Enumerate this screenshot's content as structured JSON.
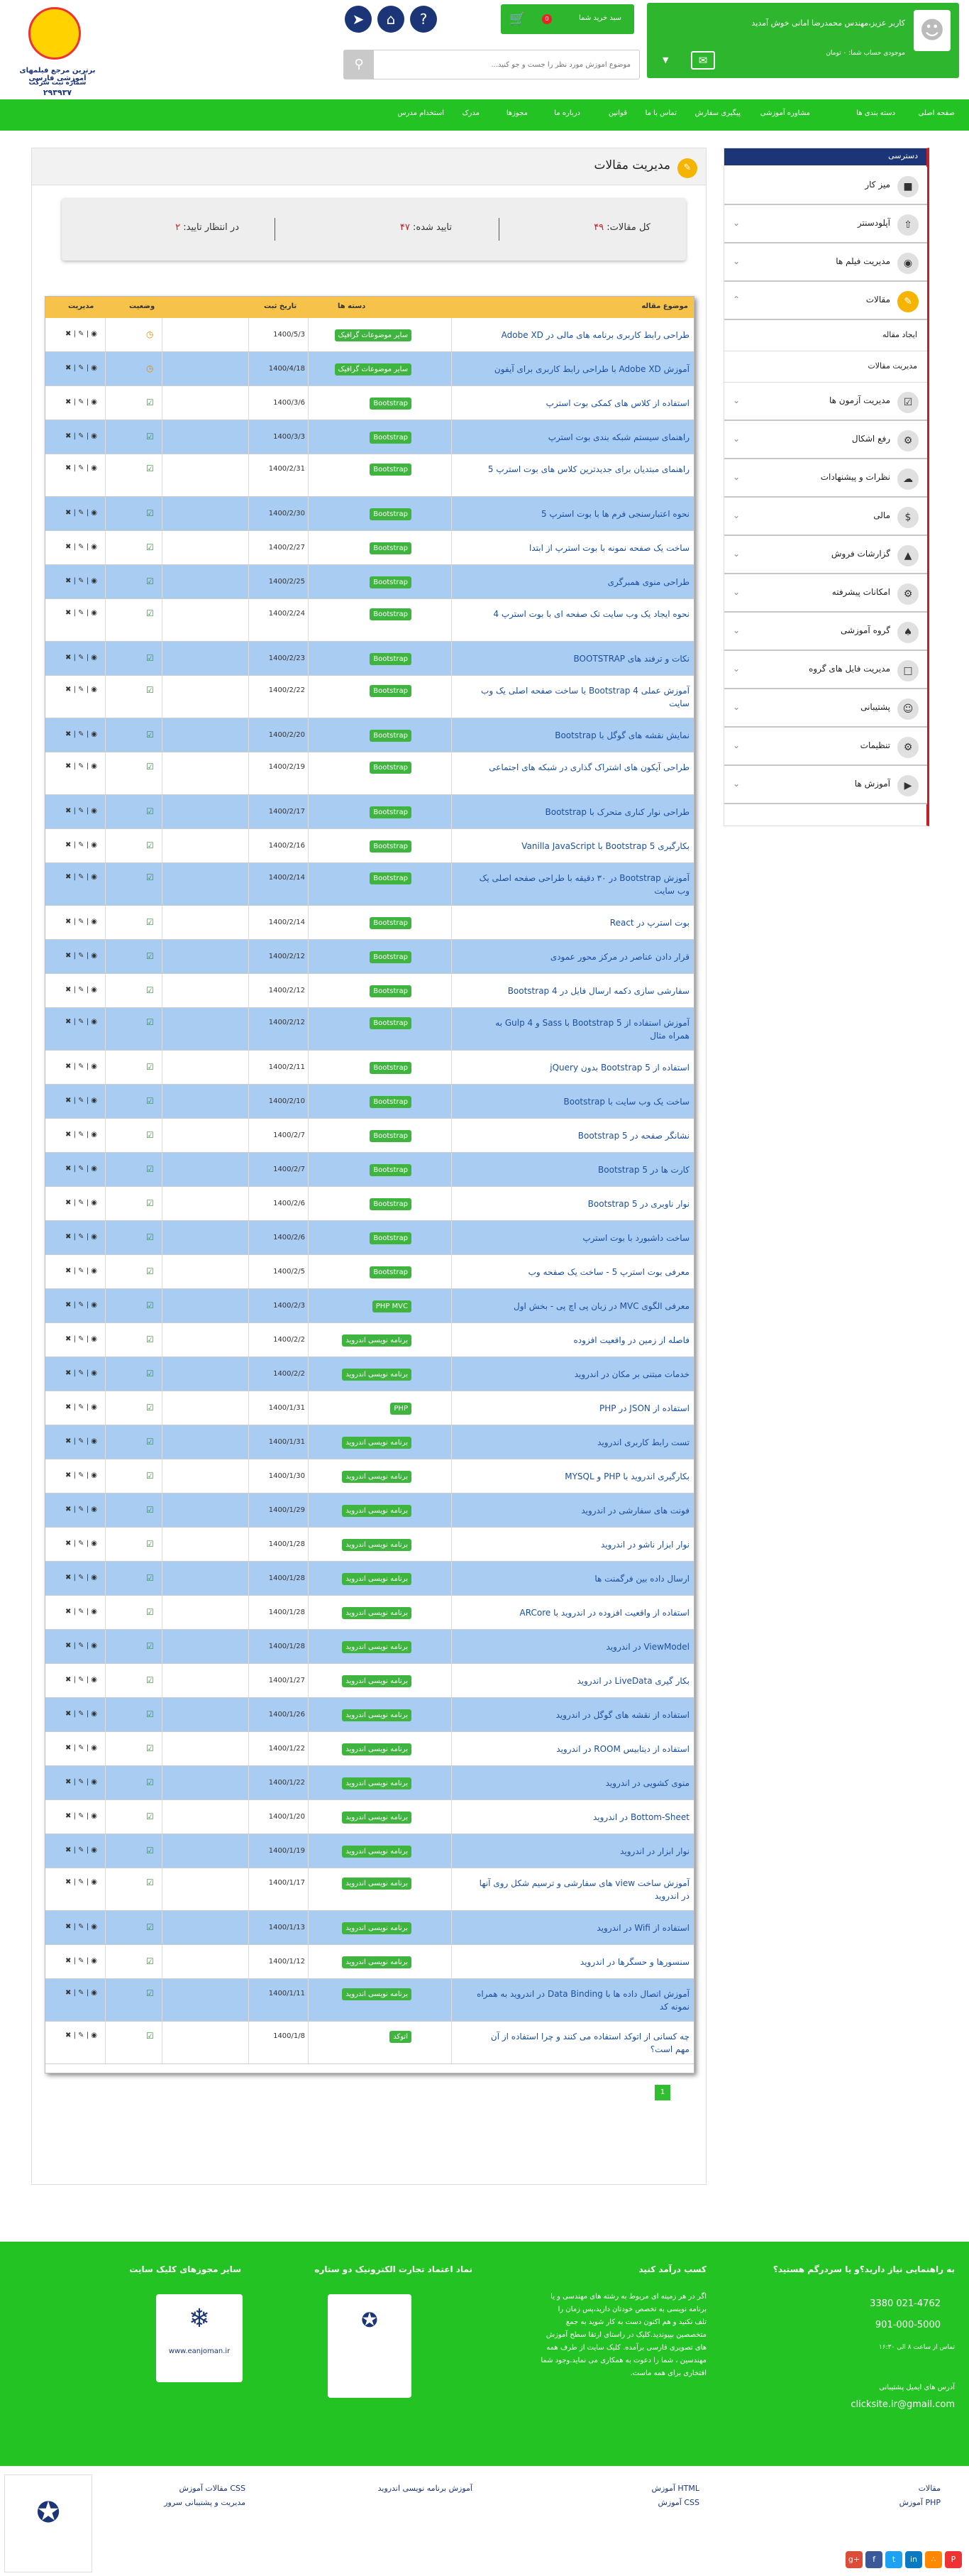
{
  "header": {
    "user_line": "کاربر عزیز،مهندس محمدرضا امانی خوش آمدید",
    "balance_line": "موجودی حساب شما: ۰ تومان",
    "cart_label": "سبد خرید شما",
    "cart_count": "0",
    "search_placeholder": "موضوع آموزش مورد نظر را جست و جو کنید...",
    "logo_line1": "برترین مرجع فیلمهای آموزشی فارسی",
    "logo_line2": "شماره ثبت شرکت",
    "logo_line3": "۲۹۳۹۳۷"
  },
  "nav": [
    "صفحه اصلی",
    "دسته بندی ها",
    "مشاوره آموزشی",
    "پیگیری سفارش",
    "تماس با ما",
    "قوانین",
    "درباره ما",
    "مجوزها",
    "مدرک",
    "استخدام مدرس"
  ],
  "sidebar": {
    "title": "دسترسی",
    "items": [
      "میز کار",
      "آپلودسنتر",
      "مدیریت فیلم ها",
      "مقالات",
      "مدیریت آزمون ها",
      "رفع اشکال",
      "نظرات و پیشنهادات",
      "مالی",
      "گزارشات فروش",
      "امکانات پیشرفته",
      "گروه آموزشی",
      "مدیریت فایل های گروه",
      "پشتیبانی",
      "تنظیمات",
      "آموزش ها"
    ],
    "sub": [
      "ایجاد مقاله",
      "مدیریت مقالات"
    ]
  },
  "page": {
    "title": "مدیریت مقالات",
    "stats": {
      "total_label": "کل مقالات:",
      "total": "۴۹",
      "approved_label": "تایید شده:",
      "approved": "۴۷",
      "pending_label": "در انتظار تایید:",
      "pending": "۲"
    },
    "columns": {
      "title": "موضوع مقاله",
      "date": "تاریخ ثبت",
      "category": "دسته ها",
      "status": "وضعیت",
      "manage": "مدیریت"
    },
    "rows": [
      {
        "title": "طراحی رابط کاربری برنامه های مالی در Adobe XD",
        "date": "1400/5/3",
        "cat": "سایر موضوعات گرافیک",
        "s": "p"
      },
      {
        "title": "آموزش Adobe XD با طراحی رابط کاربری برای آیفون",
        "date": "1400/4/18",
        "cat": "سایر موضوعات گرافیک",
        "s": "p"
      },
      {
        "title": "استفاده از کلاس های کمکی بوت استرپ",
        "date": "1400/3/6",
        "cat": "Bootstrap",
        "s": "a"
      },
      {
        "title": "راهنمای سیستم شبکه بندی بوت استرپ",
        "date": "1400/3/3",
        "cat": "Bootstrap",
        "s": "a"
      },
      {
        "title": "راهنمای مبتدیان برای جدیدترین کلاس های بوت استرپ 5",
        "date": "1400/2/31",
        "cat": "Bootstrap",
        "s": "a"
      },
      {
        "title": "نحوه اعتبارسنجی فرم ها با بوت استرپ 5",
        "date": "1400/2/30",
        "cat": "Bootstrap",
        "s": "a"
      },
      {
        "title": "ساخت یک صفحه نمونه با بوت استرپ از ابتدا",
        "date": "1400/2/27",
        "cat": "Bootstrap",
        "s": "a"
      },
      {
        "title": "طراحی منوی همبرگری",
        "date": "1400/2/25",
        "cat": "Bootstrap",
        "s": "a"
      },
      {
        "title": "نحوه ایجاد یک وب سایت تک صفحه ای با بوت استرپ 4",
        "date": "1400/2/24",
        "cat": "Bootstrap",
        "s": "a"
      },
      {
        "title": "نکات و ترفند های BOOTSTRAP",
        "date": "1400/2/23",
        "cat": "Bootstrap",
        "s": "a"
      },
      {
        "title": "آموزش عملی 4 Bootstrap با ساخت صفحه اصلی یک وب سایت",
        "date": "1400/2/22",
        "cat": "Bootstrap",
        "s": "a"
      },
      {
        "title": "نمایش نقشه های گوگل با Bootstrap",
        "date": "1400/2/20",
        "cat": "Bootstrap",
        "s": "a"
      },
      {
        "title": "طراحی آیکون های اشتراک گذاری در شبکه های اجتماعی",
        "date": "1400/2/19",
        "cat": "Bootstrap",
        "s": "a"
      },
      {
        "title": "طراحی نوار کناری متحرک با Bootstrap",
        "date": "1400/2/17",
        "cat": "Bootstrap",
        "s": "a"
      },
      {
        "title": "بکارگیری Bootstrap 5 با Vanilla JavaScript",
        "date": "1400/2/16",
        "cat": "Bootstrap",
        "s": "a"
      },
      {
        "title": "آموزش Bootstrap در ۳۰ دقیقه با طراحی صفحه اصلی یک وب سایت",
        "date": "1400/2/14",
        "cat": "Bootstrap",
        "s": "a"
      },
      {
        "title": "بوت استرپ در React",
        "date": "1400/2/14",
        "cat": "Bootstrap",
        "s": "a"
      },
      {
        "title": "قرار دادن عناصر در مرکز محور عمودی",
        "date": "1400/2/12",
        "cat": "Bootstrap",
        "s": "a"
      },
      {
        "title": "سفارشی سازی دکمه ارسال فایل در Bootstrap 4",
        "date": "1400/2/12",
        "cat": "Bootstrap",
        "s": "a"
      },
      {
        "title": "آموزش استفاده از Bootstrap 5 با Sass و Gulp 4 به همراه مثال",
        "date": "1400/2/12",
        "cat": "Bootstrap",
        "s": "a"
      },
      {
        "title": "استفاده از Bootstrap 5 بدون jQuery",
        "date": "1400/2/11",
        "cat": "Bootstrap",
        "s": "a"
      },
      {
        "title": "ساخت یک وب سایت با Bootstrap",
        "date": "1400/2/10",
        "cat": "Bootstrap",
        "s": "a"
      },
      {
        "title": "نشانگر صفحه در Bootstrap 5",
        "date": "1400/2/7",
        "cat": "Bootstrap",
        "s": "a"
      },
      {
        "title": "کارت ها در Bootstrap 5",
        "date": "1400/2/7",
        "cat": "Bootstrap",
        "s": "a"
      },
      {
        "title": "نوار ناوبری در Bootstrap 5",
        "date": "1400/2/6",
        "cat": "Bootstrap",
        "s": "a"
      },
      {
        "title": "ساخت داشبورد با بوت استرپ",
        "date": "1400/2/6",
        "cat": "Bootstrap",
        "s": "a"
      },
      {
        "title": "معرفی بوت استرپ 5 - ساخت یک صفحه وب",
        "date": "1400/2/5",
        "cat": "Bootstrap",
        "s": "a"
      },
      {
        "title": "معرفی الگوی MVC در زبان پی اچ پی - بخش اول",
        "date": "1400/2/3",
        "cat": "PHP MVC",
        "s": "a"
      },
      {
        "title": "فاصله از زمین در واقعیت افزوده",
        "date": "1400/2/2",
        "cat": "برنامه نویسی اندروید",
        "s": "a"
      },
      {
        "title": "خدمات مبتنی بر مکان در اندروید",
        "date": "1400/2/2",
        "cat": "برنامه نویسی اندروید",
        "s": "a"
      },
      {
        "title": "استفاده از JSON در PHP",
        "date": "1400/1/31",
        "cat": "PHP",
        "s": "a"
      },
      {
        "title": "تست رابط کاربری اندروید",
        "date": "1400/1/31",
        "cat": "برنامه نویسی اندروید",
        "s": "a"
      },
      {
        "title": "بکارگیری اندروید با PHP و MYSQL",
        "date": "1400/1/30",
        "cat": "برنامه نویسی اندروید",
        "s": "a"
      },
      {
        "title": "فونت های سفارشی در اندروید",
        "date": "1400/1/29",
        "cat": "برنامه نویسی اندروید",
        "s": "a"
      },
      {
        "title": "نوار ابزار ناشو در اندروید",
        "date": "1400/1/28",
        "cat": "برنامه نویسی اندروید",
        "s": "a"
      },
      {
        "title": "ارسال داده بین فرگمنت ها",
        "date": "1400/1/28",
        "cat": "برنامه نویسی اندروید",
        "s": "a"
      },
      {
        "title": "استفاده از واقعیت افزوده در اندروید با ARCore",
        "date": "1400/1/28",
        "cat": "برنامه نویسی اندروید",
        "s": "a"
      },
      {
        "title": "ViewModel در اندروید",
        "date": "1400/1/28",
        "cat": "برنامه نویسی اندروید",
        "s": "a"
      },
      {
        "title": "بکار گیری LiveData در اندروید",
        "date": "1400/1/27",
        "cat": "برنامه نویسی اندروید",
        "s": "a"
      },
      {
        "title": "استفاده از نقشه های گوگل در اندروید",
        "date": "1400/1/26",
        "cat": "برنامه نویسی اندروید",
        "s": "a"
      },
      {
        "title": "استفاده از دیتابیس ROOM در اندروید",
        "date": "1400/1/22",
        "cat": "برنامه نویسی اندروید",
        "s": "a"
      },
      {
        "title": "منوی کشویی در اندروید",
        "date": "1400/1/22",
        "cat": "برنامه نویسی اندروید",
        "s": "a"
      },
      {
        "title": "Bottom-Sheet در اندروید",
        "date": "1400/1/20",
        "cat": "برنامه نویسی اندروید",
        "s": "a"
      },
      {
        "title": "نوار ابزار در اندروید",
        "date": "1400/1/19",
        "cat": "برنامه نویسی اندروید",
        "s": "a"
      },
      {
        "title": "آموزش ساخت view های سفارشی و ترسیم شکل روی آنها در اندروید",
        "date": "1400/1/17",
        "cat": "برنامه نویسی اندروید",
        "s": "a"
      },
      {
        "title": "استفاده از Wifi در اندروید",
        "date": "1400/1/13",
        "cat": "برنامه نویسی اندروید",
        "s": "a"
      },
      {
        "title": "سنسورها و حسگرها در اندروید",
        "date": "1400/1/12",
        "cat": "برنامه نویسی اندروید",
        "s": "a"
      },
      {
        "title": "آموزش اتصال داده ها با Data Binding در اندروید به همراه نمونه کد",
        "date": "1400/1/11",
        "cat": "برنامه نویسی اندروید",
        "s": "a"
      },
      {
        "title": "چه کسانی از اتوکد استفاده می کنند و چرا استفاده از آن مهم است؟",
        "date": "1400/1/8",
        "cat": "اتوکد",
        "s": "a"
      }
    ],
    "pagination": "1"
  },
  "footer": {
    "col1_title": "به راهنمایی نیاز دارید؟و یا سردرگم هستید؟",
    "phone1": "021-4762 3380",
    "phone2": "901-000-5000",
    "hours": "تماس از ساعت ۸ الی ۱۶:۳۰",
    "email_label": "آدرس های ایمیل پشتیبانی",
    "email": "clicksite.ir@gmail.com",
    "col2_title": "کسب درآمد کنید",
    "col2_text": [
      "اگر در هر زمینه ای مربوط به رشته های مهندسی و یا",
      "برنامه نویسی به تخصص خودتان دارید،پس زمان را",
      "تلف نکنید و هم اکنون دست به کار شوید به جمع",
      "متخصصین بپیوندید.کلیک در راستای ارتقا سطح آموزش",
      "های تصویری فارسی برآمده. کلیک سایت از طرف همه",
      "مهندسین ، شما را دعوت به همکاری می نماید.وجود شما",
      "افتخاری برای همه ماست."
    ],
    "col3_title": "نماد اعتماد تجارت الکترونیک دو ستاره",
    "col4_title": "سایر مجوزهای کلیک سایت",
    "badge_text": "www.eanjoman.ir",
    "links": [
      "مقالات",
      "آموزش PHP",
      "آموزش HTML",
      "آموزش CSS",
      "آموزش برنامه نویسی اندروید",
      "مقالات آموزش CSS",
      "مدیریت و پشتیبانی سرور"
    ]
  },
  "colors": {
    "green": "#22c322",
    "navy": "#1b3577",
    "orange": "#f6c249",
    "rowblue": "#a9ccf3",
    "red": "#c42027"
  }
}
